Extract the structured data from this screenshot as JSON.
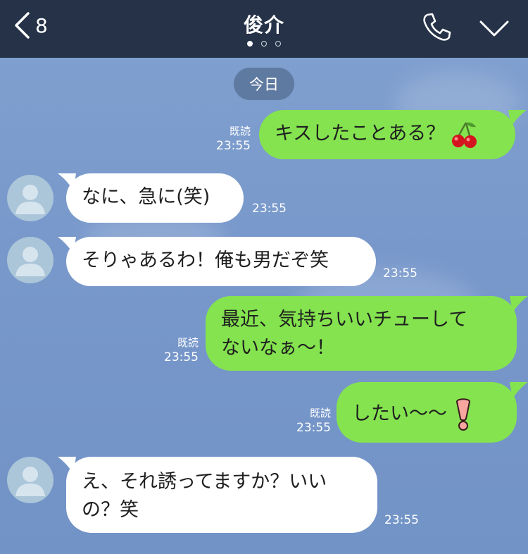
{
  "header": {
    "back_count": "8",
    "title": "俊介",
    "page_indicator": {
      "total": 3,
      "active": 1
    },
    "icons": [
      "back-chevron-icon",
      "phone-icon",
      "chevron-down-icon"
    ]
  },
  "chat": {
    "date_badge": "今日",
    "messages": [
      {
        "from": "me",
        "text": "キスしたことある？",
        "emoji": "cherry",
        "read": "既読",
        "time": "23:55"
      },
      {
        "from": "friend",
        "text": "なに、急に(笑)",
        "time": "23:55"
      },
      {
        "from": "friend",
        "text": "そりゃあるわ！俺も男だぞ笑",
        "time": "23:55"
      },
      {
        "from": "me",
        "lines": [
          "最近、気持ちいいチューして",
          "ないなぁ〜！"
        ],
        "read": "既読",
        "time": "23:55"
      },
      {
        "from": "me",
        "text": "したい〜〜",
        "emoji": "exclamation",
        "read": "既読",
        "time": "23:55"
      },
      {
        "from": "friend",
        "lines": [
          "え、それ誘ってますか？いい",
          "の？笑"
        ],
        "time": "23:55"
      }
    ]
  },
  "colors": {
    "header_bg": "#253248",
    "chat_bg": "#7b9bcc",
    "outgoing_bubble": "#84e34f",
    "incoming_bubble": "#ffffff",
    "date_badge_bg": "#5f7aa1"
  }
}
